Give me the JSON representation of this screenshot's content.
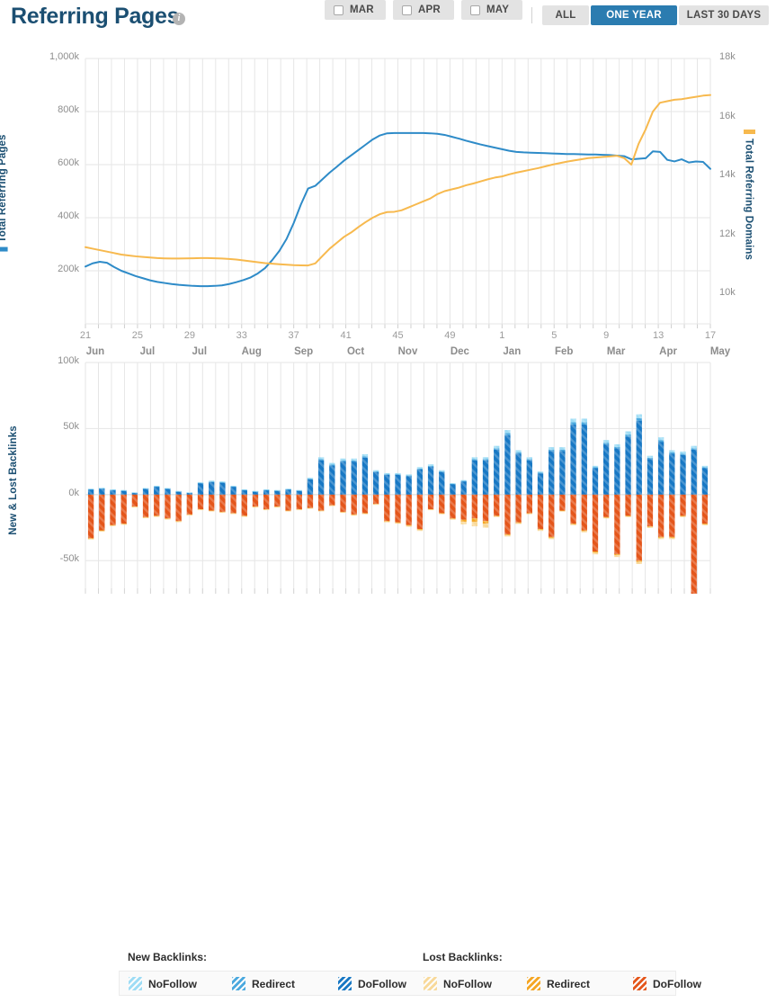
{
  "header": {
    "title": "Referring Pages",
    "info_icon": "info-icon",
    "month_toggles": [
      {
        "label": "MAR",
        "checked": false
      },
      {
        "label": "APR",
        "checked": false
      },
      {
        "label": "MAY",
        "checked": false
      }
    ],
    "range_buttons": [
      {
        "label": "ALL",
        "active": false
      },
      {
        "label": "ONE YEAR",
        "active": true
      },
      {
        "label": "LAST 30 DAYS",
        "active": false
      }
    ]
  },
  "colors": {
    "title": "#1b4f72",
    "accent_blue": "#2b7cb0",
    "line_pages": "#2e8bc8",
    "line_domains": "#f7b94e",
    "new_nofollow": "#9ddcf5",
    "new_redirect": "#4aa8de",
    "new_dofollow": "#1878c4",
    "lost_nofollow": "#f8d99a",
    "lost_redirect": "#f5a623",
    "lost_dofollow": "#e4561b",
    "grid": "#e6e6e6"
  },
  "legend": {
    "new_title": "New Backlinks:",
    "lost_title": "Lost Backlinks:",
    "new_items": [
      {
        "label": "NoFollow",
        "color": "#9ddcf5"
      },
      {
        "label": "Redirect",
        "color": "#4aa8de"
      },
      {
        "label": "DoFollow",
        "color": "#1878c4"
      }
    ],
    "lost_items": [
      {
        "label": "NoFollow",
        "color": "#f8d99a"
      },
      {
        "label": "Redirect",
        "color": "#f5a623"
      },
      {
        "label": "DoFollow",
        "color": "#e4561b"
      }
    ]
  },
  "chart_data": [
    {
      "type": "line",
      "title": "Referring Pages",
      "ylabel": "Total Referring Pages",
      "y2label": "Total Referring Domains",
      "xlabel": "",
      "grid": true,
      "ylim": [
        0,
        1000000
      ],
      "y2lim": [
        9000,
        18000
      ],
      "yticks": [
        0,
        200000,
        400000,
        600000,
        800000,
        1000000
      ],
      "ytick_labels": [
        "",
        "200k",
        "400k",
        "600k",
        "800k",
        "1,000k"
      ],
      "y2ticks": [
        10000,
        12000,
        14000,
        16000,
        18000
      ],
      "y2tick_labels": [
        "10k",
        "12k",
        "14k",
        "16k",
        "18k"
      ],
      "xtick_labels": [
        "21",
        "25",
        "29",
        "33",
        "37",
        "41",
        "45",
        "49",
        "1",
        "5",
        "9",
        "13",
        "17"
      ],
      "xtick_months": [
        "Jun",
        "Jul",
        "Jul",
        "Aug",
        "Sep",
        "Oct",
        "Nov",
        "Dec",
        "Jan",
        "Feb",
        "Mar",
        "Apr",
        "May"
      ],
      "series": [
        {
          "name": "Total Referring Pages",
          "color": "#2e8bc8",
          "axis": "left",
          "values": [
            216000,
            228000,
            234000,
            230000,
            214000,
            200000,
            190000,
            180000,
            172000,
            164000,
            158000,
            154000,
            150000,
            147000,
            145000,
            143000,
            142000,
            142000,
            143000,
            145000,
            150000,
            157000,
            165000,
            175000,
            190000,
            210000,
            240000,
            275000,
            320000,
            380000,
            450000,
            510000,
            520000,
            545000,
            570000,
            592000,
            615000,
            635000,
            655000,
            675000,
            695000,
            710000,
            718000,
            719000,
            719000,
            719000,
            719000,
            719000,
            718000,
            716000,
            712000,
            705000,
            698000,
            690000,
            683000,
            676000,
            670000,
            664000,
            658000,
            652000,
            648000,
            646000,
            645000,
            644000,
            643000,
            642000,
            641000,
            640000,
            640000,
            639000,
            638000,
            638000,
            637000,
            636000,
            634000,
            632000,
            620000,
            622000,
            624000,
            650000,
            648000,
            618000,
            612000,
            620000,
            608000,
            612000,
            610000,
            584000
          ]
        },
        {
          "name": "Total Referring Domains",
          "color": "#f7b94e",
          "axis": "right",
          "values": [
            11600,
            11550,
            11500,
            11450,
            11400,
            11350,
            11320,
            11290,
            11270,
            11250,
            11230,
            11220,
            11215,
            11215,
            11220,
            11225,
            11230,
            11230,
            11225,
            11215,
            11200,
            11180,
            11150,
            11120,
            11090,
            11060,
            11040,
            11020,
            11005,
            10990,
            10985,
            10980,
            11050,
            11300,
            11550,
            11750,
            11950,
            12100,
            12280,
            12450,
            12600,
            12720,
            12790,
            12800,
            12850,
            12950,
            13050,
            13150,
            13250,
            13400,
            13500,
            13560,
            13620,
            13700,
            13760,
            13830,
            13900,
            13960,
            14000,
            14070,
            14130,
            14180,
            14230,
            14280,
            14340,
            14400,
            14450,
            14500,
            14540,
            14580,
            14620,
            14640,
            14660,
            14680,
            14700,
            14620,
            14400,
            15100,
            15600,
            16200,
            16500,
            16550,
            16600,
            16620,
            16660,
            16700,
            16740,
            16760
          ]
        }
      ]
    },
    {
      "type": "bar",
      "title": "New & Lost Backlinks",
      "ylabel": "New & Lost Backlinks",
      "grid": true,
      "ylim": [
        -75000,
        100000
      ],
      "yticks": [
        -50000,
        0,
        50000,
        100000
      ],
      "ytick_labels": [
        "-50k",
        "0k",
        "50k",
        "100k"
      ],
      "stacked": true,
      "series": [
        {
          "name": "New DoFollow",
          "color": "#1878c4",
          "values": [
            4000,
            4500,
            3500,
            3000,
            1500,
            4500,
            6000,
            4500,
            2500,
            1500,
            8500,
            9500,
            9000,
            6000,
            3500,
            2500,
            3500,
            3000,
            4000,
            3000,
            11500,
            26000,
            22000,
            25000,
            25000,
            28000,
            17000,
            15000,
            15000,
            14000,
            19000,
            21000,
            17000,
            8000,
            10000,
            26000,
            26000,
            34000,
            45000,
            31000,
            26000,
            16000,
            33000,
            33000,
            53000,
            53000,
            20000,
            38000,
            35000,
            44000,
            56000,
            27000,
            40000,
            31000,
            30000,
            34000,
            20000
          ]
        },
        {
          "name": "New Redirect",
          "color": "#4aa8de",
          "values": [
            200,
            300,
            200,
            200,
            100,
            200,
            300,
            200,
            100,
            100,
            400,
            400,
            400,
            300,
            200,
            100,
            200,
            200,
            200,
            200,
            500,
            900,
            800,
            900,
            900,
            1000,
            600,
            500,
            500,
            500,
            700,
            700,
            600,
            300,
            400,
            900,
            900,
            1100,
            1500,
            1000,
            900,
            600,
            1100,
            1100,
            1700,
            1700,
            700,
            1300,
            1200,
            1500,
            1800,
            900,
            1300,
            1000,
            1000,
            1100,
            700
          ]
        },
        {
          "name": "New NoFollow",
          "color": "#9ddcf5",
          "values": [
            300,
            400,
            300,
            300,
            200,
            300,
            400,
            300,
            200,
            200,
            600,
            700,
            600,
            400,
            300,
            200,
            300,
            300,
            300,
            300,
            800,
            1400,
            1200,
            1400,
            1400,
            1600,
            900,
            800,
            800,
            800,
            1100,
            1200,
            900,
            400,
            600,
            1400,
            1400,
            1800,
            2400,
            1600,
            1400,
            900,
            1800,
            1800,
            2800,
            2800,
            1100,
            2000,
            1900,
            2400,
            3000,
            1500,
            2100,
            1600,
            1600,
            1800,
            1100
          ]
        },
        {
          "name": "Lost DoFollow",
          "color": "#e4561b",
          "values": [
            -33000,
            -27000,
            -23000,
            -22000,
            -9000,
            -17000,
            -16000,
            -18000,
            -20000,
            -15000,
            -11000,
            -12000,
            -13000,
            -14000,
            -16000,
            -9000,
            -11000,
            -9000,
            -12000,
            -11000,
            -10000,
            -12000,
            -8000,
            -13000,
            -15000,
            -14000,
            -7000,
            -20000,
            -21000,
            -23000,
            -26000,
            -11000,
            -14000,
            -18000,
            -19000,
            -18000,
            -20000,
            -16000,
            -30000,
            -21000,
            -14000,
            -26000,
            -32000,
            -12000,
            -22000,
            -27000,
            -43000,
            -17000,
            -45000,
            -16000,
            -50000,
            -24000,
            -32000,
            -32000,
            -16000,
            -77000,
            -22000
          ]
        },
        {
          "name": "Lost Redirect",
          "color": "#f5a623",
          "values": [
            -400,
            -400,
            -300,
            -300,
            -200,
            -300,
            -300,
            -300,
            -300,
            -200,
            -200,
            -200,
            -200,
            -200,
            -300,
            -200,
            -200,
            -200,
            -200,
            -200,
            -200,
            -200,
            -200,
            -200,
            -300,
            -300,
            -200,
            -400,
            -400,
            -500,
            -600,
            -200,
            -300,
            -400,
            -1500,
            -2500,
            -2000,
            -400,
            -700,
            -500,
            -300,
            -600,
            -700,
            -300,
            -500,
            -600,
            -900,
            -400,
            -900,
            -400,
            -1000,
            -500,
            -700,
            -700,
            -400,
            -1200,
            -500
          ]
        },
        {
          "name": "Lost NoFollow",
          "color": "#f8d99a",
          "values": [
            -600,
            -600,
            -500,
            -400,
            -200,
            -400,
            -500,
            -400,
            -400,
            -300,
            -300,
            -300,
            -300,
            -300,
            -400,
            -300,
            -300,
            -300,
            -300,
            -300,
            -300,
            -300,
            -300,
            -300,
            -400,
            -400,
            -300,
            -600,
            -600,
            -800,
            -900,
            -300,
            -500,
            -600,
            -2000,
            -3500,
            -3000,
            -600,
            -1000,
            -700,
            -500,
            -900,
            -1000,
            -400,
            -700,
            -900,
            -1300,
            -600,
            -1300,
            -600,
            -1500,
            -700,
            -1000,
            -1000,
            -600,
            -1800,
            -700
          ]
        }
      ]
    }
  ]
}
